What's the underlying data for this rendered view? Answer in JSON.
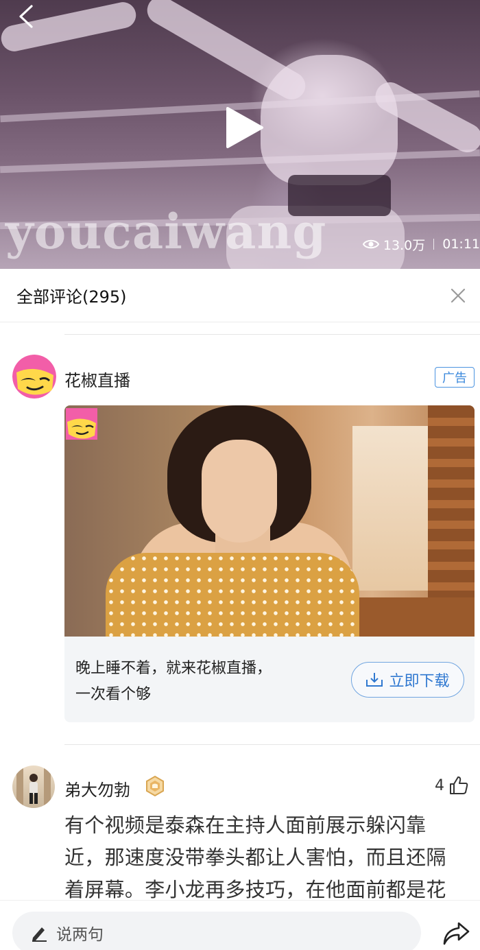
{
  "video": {
    "watermark": "youcaiwang",
    "views": "13.0万",
    "duration": "01:11",
    "icons": {
      "back": "chevron-left-icon",
      "play": "play-icon",
      "views": "eye-icon"
    }
  },
  "comments": {
    "title": "全部评论(295)",
    "close_icon": "close-icon"
  },
  "ad": {
    "name": "花椒直播",
    "badge": "广告",
    "text_line1": "晚上睡不着，就来花椒直播，",
    "text_line2": "一次看个够",
    "download_label": "立即下载",
    "colors": {
      "logo_pink": "#f25ea8",
      "logo_yellow": "#ffd84a",
      "link_blue": "#2f78d0"
    }
  },
  "comment": {
    "username": "弟大勿勃",
    "likes": "4",
    "line1": "有个视频是泰森在主持人面前展示躲闪靠",
    "line2": "近，那速度没带拳头都让人害怕，而且还隔",
    "line3": "着屏幕。李小龙再多技巧，在他面前都是花"
  },
  "bottom_bar": {
    "placeholder": "说两句",
    "share_icon": "share-icon"
  }
}
